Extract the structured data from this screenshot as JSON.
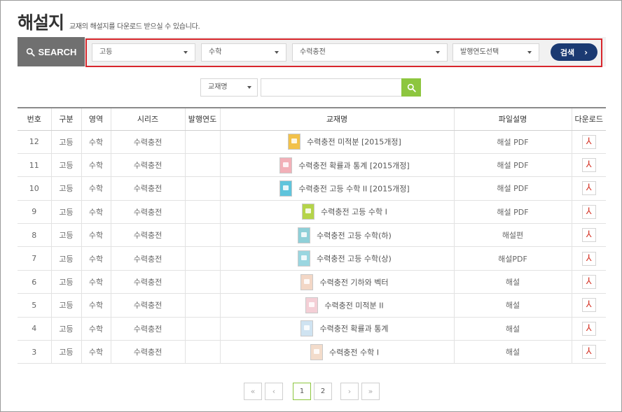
{
  "header": {
    "title": "해설지",
    "subtitle": "교재의 해설지를 다운로드 받으실 수 있습니다."
  },
  "search": {
    "label": "SEARCH",
    "level_select": "고등",
    "subject_select": "수학",
    "series_select": "수력충전",
    "year_select": "발행연도선택",
    "button_label": "검색"
  },
  "filter": {
    "field_select": "교재명",
    "input_value": ""
  },
  "table": {
    "headers": [
      "번호",
      "구분",
      "영역",
      "시리즈",
      "발행연도",
      "교재명",
      "파일설명",
      "다운로드"
    ],
    "rows": [
      {
        "no": "12",
        "level": "고등",
        "area": "수학",
        "series": "수력충전",
        "year": "",
        "title": "수력충전 미적분 [2015개정]",
        "file": "해설 PDF",
        "cover": "#f2c14a"
      },
      {
        "no": "11",
        "level": "고등",
        "area": "수학",
        "series": "수력충전",
        "year": "",
        "title": "수력충전 확률과 통계 [2015개정]",
        "file": "해설 PDF",
        "cover": "#f2b0b8"
      },
      {
        "no": "10",
        "level": "고등",
        "area": "수학",
        "series": "수력충전",
        "year": "",
        "title": "수력충전 고등 수학 II [2015개정]",
        "file": "해설 PDF",
        "cover": "#5fc4dc"
      },
      {
        "no": "9",
        "level": "고등",
        "area": "수학",
        "series": "수력충전",
        "year": "",
        "title": "수력충전 고등 수학 I",
        "file": "해설 PDF",
        "cover": "#b5d44a"
      },
      {
        "no": "8",
        "level": "고등",
        "area": "수학",
        "series": "수력충전",
        "year": "",
        "title": "수력충전 고등 수학(하)",
        "file": "해설편",
        "cover": "#8fd0d8"
      },
      {
        "no": "7",
        "level": "고등",
        "area": "수학",
        "series": "수력충전",
        "year": "",
        "title": "수력충전 고등 수학(상)",
        "file": "해설PDF",
        "cover": "#9ad6e0"
      },
      {
        "no": "6",
        "level": "고등",
        "area": "수학",
        "series": "수력충전",
        "year": "",
        "title": "수력충전 기하와 벡터",
        "file": "해설",
        "cover": "#f3d7c6"
      },
      {
        "no": "5",
        "level": "고등",
        "area": "수학",
        "series": "수력충전",
        "year": "",
        "title": "수력충전 미적분 II",
        "file": "해설",
        "cover": "#f4cfd6"
      },
      {
        "no": "4",
        "level": "고등",
        "area": "수학",
        "series": "수력충전",
        "year": "",
        "title": "수력충전 확률과 통계",
        "file": "해설",
        "cover": "#cfe3f1"
      },
      {
        "no": "3",
        "level": "고등",
        "area": "수학",
        "series": "수력충전",
        "year": "",
        "title": "수력충전 수학 I",
        "file": "해설",
        "cover": "#f3dccb"
      }
    ]
  },
  "pagination": {
    "first": "«",
    "prev": "‹",
    "pages": [
      "1",
      "2"
    ],
    "current": "1",
    "next": "›",
    "last": "»"
  },
  "colors": {
    "search_label_bg": "#707070",
    "highlight_border": "#d8262c",
    "search_button_bg": "#1b3a72",
    "filter_button_bg": "#8dc63f",
    "pdf_icon": "#d63a2c"
  },
  "icons": {
    "search": "search-icon",
    "dropdown": "caret-down-icon",
    "download": "pdf-icon"
  }
}
